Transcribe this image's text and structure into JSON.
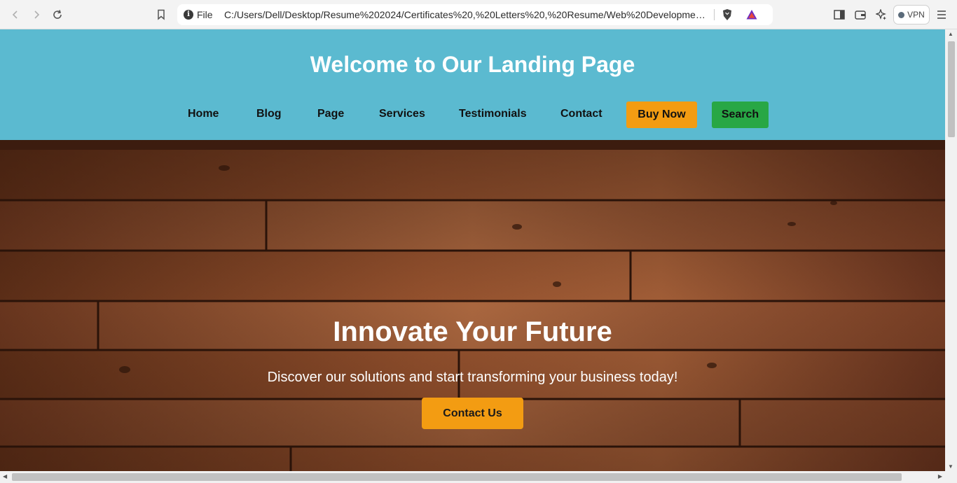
{
  "browser": {
    "address_scheme": "File",
    "url": "C:/Users/Dell/Desktop/Resume%202024/Certificates%20,%20Letters%20,%20Resume/Web%20Development...",
    "vpn_label": "VPN"
  },
  "header": {
    "title": "Welcome to Our Landing Page",
    "nav": [
      "Home",
      "Blog",
      "Page",
      "Services",
      "Testimonials",
      "Contact"
    ],
    "buy_label": "Buy Now",
    "search_label": "Search"
  },
  "hero": {
    "title": "Innovate Your Future",
    "subtitle": "Discover our solutions and start transforming your business today!",
    "cta_label": "Contact Us"
  },
  "colors": {
    "header_bg": "#5bbad0",
    "buy_button": "#f39c12",
    "search_button": "#28a745",
    "cta_button": "#f39c12"
  }
}
